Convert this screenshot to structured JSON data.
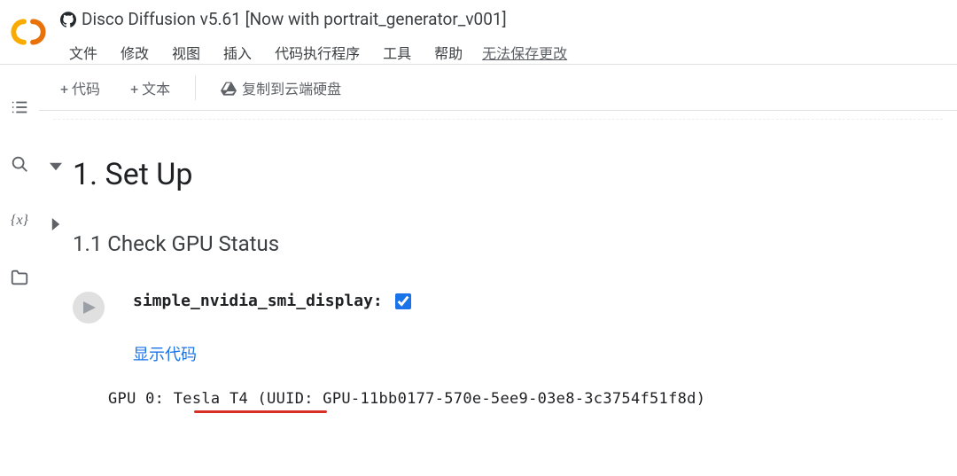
{
  "header": {
    "title": "Disco Diffusion v5.61 [Now with portrait_generator_v001]",
    "menu": {
      "file": "文件",
      "edit": "修改",
      "view": "视图",
      "insert": "插入",
      "runtime": "代码执行程序",
      "tools": "工具",
      "help": "帮助"
    },
    "save_status": "无法保存更改"
  },
  "toolbar": {
    "add_code": "+ 代码",
    "add_text": "+ 文本",
    "copy_drive": "复制到云端硬盘"
  },
  "sidebar": {
    "toc": "table-of-contents",
    "search": "search",
    "vars": "variables",
    "files": "files"
  },
  "notebook": {
    "section1_title": "1. Set Up",
    "section11_title": "1.1 Check GPU Status",
    "form": {
      "bool_var_label": "simple_nvidia_smi_display:",
      "bool_var_checked": true,
      "show_code": "显示代码"
    },
    "output_line": "GPU 0: Tesla T4 (UUID: GPU-11bb0177-570e-5ee9-03e8-3c3754f51f8d)"
  }
}
